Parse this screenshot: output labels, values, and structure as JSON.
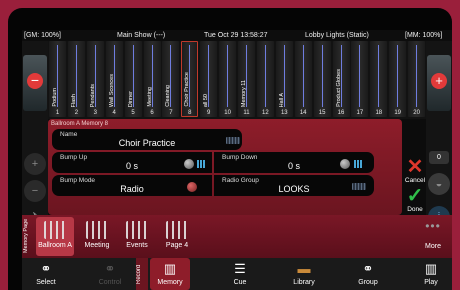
{
  "status": {
    "gm": "[GM: 100%]",
    "show": "Main Show (---)",
    "datetime": "Tue Oct 29 13:58:27",
    "look": "Lobby Lights (Static)",
    "mm": "[MM: 100%]"
  },
  "faders": [
    {
      "num": "1",
      "label": "Podium"
    },
    {
      "num": "2",
      "label": "Flash"
    },
    {
      "num": "3",
      "label": "Pendants"
    },
    {
      "num": "4",
      "label": "Wall Sconces"
    },
    {
      "num": "5",
      "label": "Dinner"
    },
    {
      "num": "6",
      "label": "Meeting"
    },
    {
      "num": "7",
      "label": "Cleaning"
    },
    {
      "num": "8",
      "label": "Choir Practice"
    },
    {
      "num": "9",
      "label": "all 50"
    },
    {
      "num": "10",
      "label": ""
    },
    {
      "num": "11",
      "label": "Memory 11"
    },
    {
      "num": "12",
      "label": ""
    },
    {
      "num": "13",
      "label": "Hall A"
    },
    {
      "num": "14",
      "label": ""
    },
    {
      "num": "15",
      "label": ""
    },
    {
      "num": "16",
      "label": "Product Globes"
    },
    {
      "num": "17",
      "label": ""
    },
    {
      "num": "18",
      "label": ""
    },
    {
      "num": "19",
      "label": ""
    },
    {
      "num": "20",
      "label": ""
    }
  ],
  "right_sidebar": {
    "counter": "0"
  },
  "editor": {
    "title": "Ballroom A Memory 8",
    "name_label": "Name",
    "name_value": "Choir Practice",
    "bump_up_label": "Bump Up",
    "bump_up_value": "0 s",
    "bump_down_label": "Bump Down",
    "bump_down_value": "0 s",
    "bump_mode_label": "Bump Mode",
    "bump_mode_value": "Radio",
    "radio_group_label": "Radio Group",
    "radio_group_value": "LOOKS"
  },
  "actions": {
    "cancel": "Cancel",
    "done": "Done"
  },
  "memory_page": {
    "label": "Memory Page",
    "tabs": [
      "Ballroom A",
      "Meeting",
      "Events",
      "Page 4"
    ],
    "more": "More"
  },
  "bottom_tabs": {
    "select": "Select",
    "control": "Control",
    "record": "Record",
    "memory": "Memory",
    "cue": "Cue",
    "library": "Library",
    "group": "Group",
    "play": "Play"
  },
  "colors": {
    "accent": "#8e1d2a",
    "background": "#9a1f3b",
    "cancel": "#e0372c",
    "done": "#2fbf4a"
  }
}
